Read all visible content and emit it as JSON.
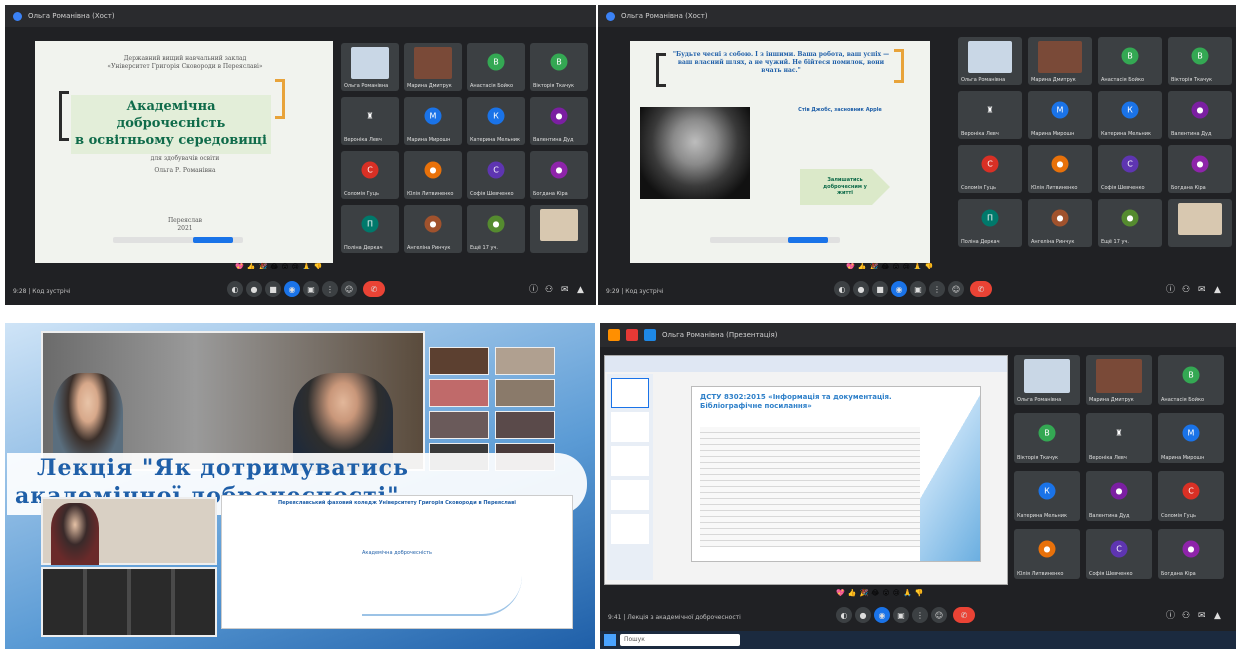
{
  "q1": {
    "window_title": "Ольга Романівна (Хост)",
    "slide": {
      "header": "Державний вищий навчальний заклад «Університет Григорія Сковороди в Переяславі»",
      "title_line1": "Академічна доброчесність",
      "title_line2": "в освітньому середовищі",
      "sub": "для здобувачів освіти",
      "author": "Ольга Р. Романівна",
      "city": "Переяслав",
      "year": "2021"
    },
    "tiles": [
      {
        "name": "Ольга Романівна",
        "kind": "photo",
        "color": "#c9d7e6"
      },
      {
        "name": "Марина Дмитрук",
        "kind": "photo",
        "color": "#7a4a38"
      },
      {
        "name": "Анастасія Бойко",
        "kind": "avatar",
        "letter": "В",
        "color": "#34a853"
      },
      {
        "name": "Вікторія Ткачук",
        "kind": "avatar",
        "letter": "В",
        "color": "#34a853"
      },
      {
        "name": "Вероніка Левч",
        "kind": "avatar",
        "letter": "♜",
        "color": "#3c4043"
      },
      {
        "name": "Марина Мирошн",
        "kind": "avatar",
        "letter": "М",
        "color": "#1a73e8"
      },
      {
        "name": "Катерина Мельник",
        "kind": "avatar",
        "letter": "К",
        "color": "#1a73e8"
      },
      {
        "name": "Валентина Дуд",
        "kind": "avatar",
        "letter": "●",
        "color": "#7b1fa2"
      },
      {
        "name": "Соломія Гуць",
        "kind": "avatar",
        "letter": "С",
        "color": "#d93025"
      },
      {
        "name": "Юлія Литвиненко",
        "kind": "avatar",
        "letter": "●",
        "color": "#e8710a"
      },
      {
        "name": "Софія Шевченко",
        "kind": "avatar",
        "letter": "С",
        "color": "#5e35b1"
      },
      {
        "name": "Богдана Кіра",
        "kind": "avatar",
        "letter": "●",
        "color": "#8e24aa"
      },
      {
        "name": "Поліна Деркач",
        "kind": "avatar",
        "letter": "П",
        "color": "#00796b"
      },
      {
        "name": "Ангеліна Ринчук",
        "kind": "avatar",
        "letter": "●",
        "color": "#a0522d"
      },
      {
        "name": "Ещё 17 уч.",
        "kind": "avatar",
        "letter": "●",
        "color": "#558b2f"
      },
      {
        "name": "",
        "kind": "photo",
        "color": "#d8c8b0"
      }
    ],
    "time": "9:28 | Код зустрічі"
  },
  "q2": {
    "window_title": "Ольга Романівна (Хост)",
    "quote": "\"Будьте чесні з собою. І з іншими. Ваша робота, ваш успіх — ваш власний шлях, а не чужий. Не бійтеся помилок, вони вчать нас.\"",
    "quote_author": "Стів Джобс, засновник Apple",
    "arrow_text": "Залишатись доброчесним у житті",
    "time": "9:29 | Код зустрічі"
  },
  "q3": {
    "banner_line1": "Лекція \"Як дотримуватись",
    "banner_line2": "академічної доброчесності\"",
    "slide_header": "Переяславський фаховий коледж Університету Григорія Сковороди в Переяславі",
    "slide_sub": "Академічна доброчесність"
  },
  "q4": {
    "window_title": "Ольга Романівна (Презентація)",
    "slide_title": "ДСТУ 8302:2015 «Інформація та документація. Бібліографічне посилання»",
    "taskbar_text": "Пошук",
    "time": "9:41 | Лекція з академічної доброчесності"
  },
  "reactions": [
    "💖",
    "👍",
    "🎉",
    "😂",
    "😮",
    "😢",
    "🙏",
    "👎"
  ]
}
